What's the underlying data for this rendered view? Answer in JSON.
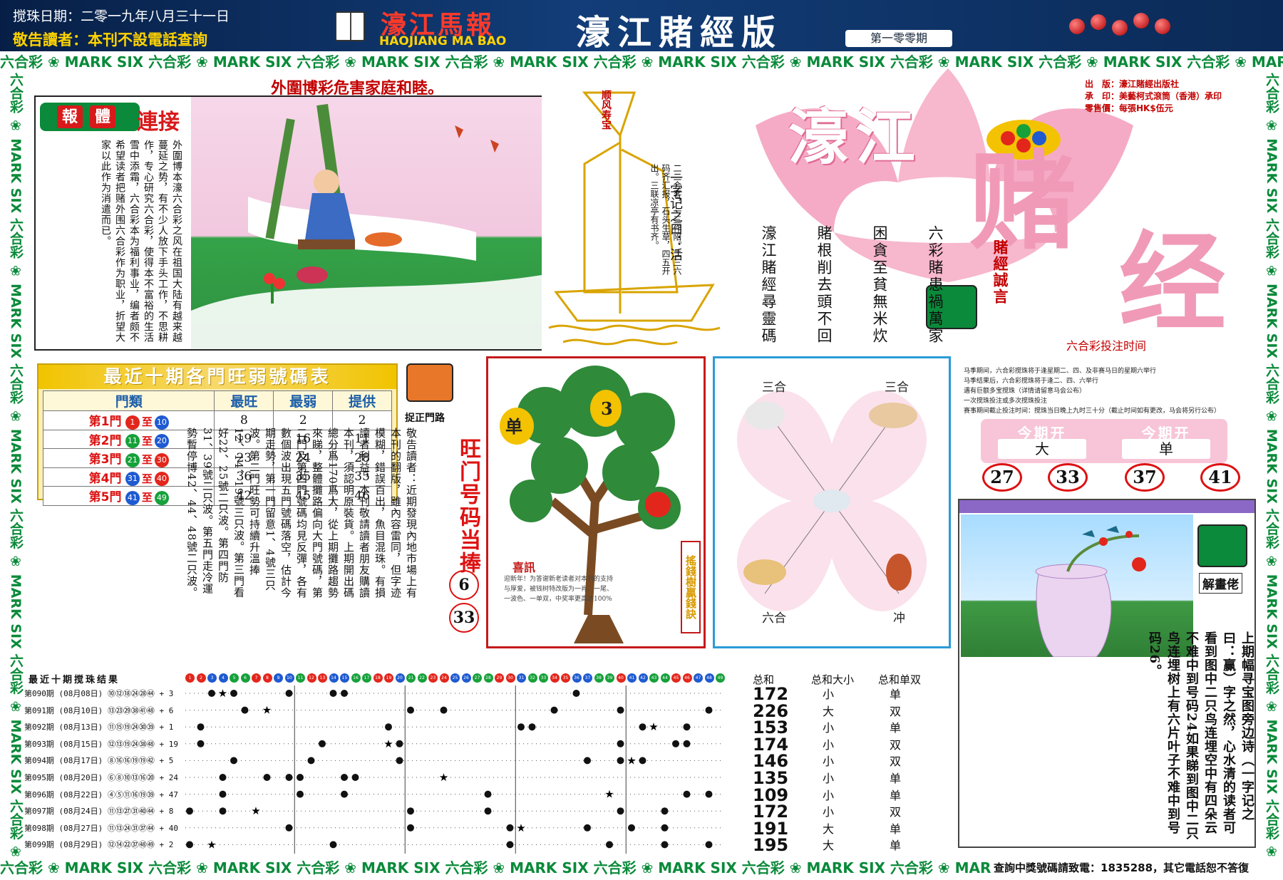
{
  "header": {
    "date": "搅珠日期：二零一九年八月三十一日",
    "notice": "敬告讀者：本刊不設電話查詢",
    "logo_cn": "濠江馬報",
    "logo_en": "HAOJIANG MA BAO",
    "edition": "濠江賭經版",
    "issue": "第一零零期"
  },
  "band_text": "六合彩 ❀ MARK SIX 六合彩 ❀ MARK SIX 六合彩 ❀ MARK SIX 六合彩 ❀ MARK SIX 六合彩 ❀ MARK SIX 六合彩 ❀ MARK SIX 六合彩 ❀ MARK SIX 六合彩 ❀ MARK SIX 六合彩 ❀ MARK SIX 六合彩 ❀ MARK SIX",
  "headline": "外圍博彩危害家庭和睦。",
  "pic_panel": {
    "badge_1": "報",
    "badge_2": "體",
    "badge_3": "連接",
    "body": "外圍博本濠六合彩之风在祖国大陆有越来越蔓延之势，有不少人放下手头工作，不思耕作，专心研究六合彩，使得本不富裕的生活雪中添霜，六合彩本为福利事业，编者颇不希望读者把赌外围六合彩作为职业，折望大家以此作为消遣而已。"
  },
  "ship": {
    "flag": "顺风寿宝",
    "poem": "二二会客，一三作陪。二三六码齐汇报，石头生草，四五开出。三联凉亭有书齐。",
    "title": "一字记之曰：活"
  },
  "logo": {
    "word_1": "濠江",
    "word_2": "赌",
    "word_3": "经"
  },
  "publisher": {
    "line_1": "出　版：濠江賭經出版社",
    "line_2": "承　印：美藝柯式滾筒（香港）承印",
    "line_3": "零售價：每張HK$伍元"
  },
  "motto": {
    "title": "賭經誠言",
    "col_1": "六彩賭患禍萬家",
    "col_2": "困貪至貧無米炊",
    "col_3": "賭根削去頭不回",
    "col_4": "濠江賭經尋靈碼"
  },
  "bet_time_title": "六合彩投注时间",
  "table": {
    "title": "最近十期各門旺弱號碼表",
    "headers": [
      "門類",
      "最旺",
      "最弱",
      "提供"
    ],
    "sep": "至",
    "rows": [
      {
        "door": "第1門",
        "from": "1",
        "to": "10",
        "hot": "8",
        "cold": "2",
        "offer": "2",
        "c1": "#e3261c",
        "c2": "#1f5ad1"
      },
      {
        "door": "第2門",
        "from": "11",
        "to": "20",
        "hot": "19",
        "cold": "16",
        "offer": "11",
        "c1": "#16a13a",
        "c2": "#1f5ad1"
      },
      {
        "door": "第3門",
        "from": "21",
        "to": "30",
        "hot": "23",
        "cold": "24",
        "offer": "28",
        "c1": "#16a13a",
        "c2": "#e3261c"
      },
      {
        "door": "第4門",
        "from": "31",
        "to": "40",
        "hot": "36",
        "cold": "35",
        "offer": "35",
        "c1": "#1f5ad1",
        "c2": "#e3261c"
      },
      {
        "door": "第5門",
        "from": "41",
        "to": "49",
        "hot": "42",
        "cold": "45",
        "offer": "46",
        "c1": "#1f5ad1",
        "c2": "#16a13a"
      }
    ]
  },
  "strategy": {
    "label": "捉正門路",
    "body": "敬告讀者：近期發現內地市場上有本刊的翻版，雖內容雷同，但字迹模糊，錯誤百出，魚目混珠。有損讀者利益，本刊敬請讀者朋友購讀本刊，須認明原裝貨。上期開出碼總分爲170爲大，從上期攤路趨勢來睇，整體攤路偏向大門號碼，第二門及第四門號碼均見反彈，各有數個波出現五門號碼落空，估計今期走勢，第一門留意1、4號三只波。第二門旺勢可持續升溫捧12、14、19號三只波。第三門看好22、25號二只波。第四門防31、39號二只波。第五門走冷運勢暫停博42、44、48號二只波。",
    "hot_title": "旺门号码当捧",
    "hot_1": "6",
    "hot_2": "33"
  },
  "tree": {
    "label_1": "单",
    "label_2": "3",
    "title": "喜訊",
    "text": "迎新年！为答谢新老读者对本刊的支持与厚爱，被钱树特改版为一肖、一尾、一波色、一单双，中奖率更高达100%",
    "side": "搖錢樹贏錢訣"
  },
  "zodiac": {
    "tl": "三合",
    "tr": "三合",
    "bl": "六合",
    "br": "冲"
  },
  "bet_info": [
    "马季期间，六合彩搅珠将于逢星期二、四、及非赛马日的星期六举行",
    "马季结果后，六合彩搅珠将于逢二、四、六举行",
    "遇有巨额多宝搅珠（详情请留意马会公布）",
    "一次搅珠投注或多次搅珠投注",
    "赛事期间截止投注时间：搅珠当日晚上九时三十分（截止时间如有更改，马会将另行公布）"
  ],
  "period": {
    "tag": "今期开",
    "val_1": "大",
    "val_2": "单"
  },
  "results": [
    "27",
    "33",
    "37",
    "41"
  ],
  "decode": {
    "label": "解畫佬",
    "body": "上期幅寻宝图旁边诗（一字记之曰：赢）字之然，心水清的读者可看到图中二只鸟连埋空中有四朵云不难中到号码24如果睇到图中二只鸟连埋树上有六片叶子不难中到号码26。"
  },
  "draw_chart": {
    "title": "最近十期搅珠结果",
    "ball_colors": [
      "#e3261c",
      "#e3261c",
      "#1f5ad1",
      "#1f5ad1",
      "#16a13a",
      "#16a13a",
      "#e3261c",
      "#e3261c",
      "#1f5ad1",
      "#1f5ad1",
      "#16a13a",
      "#e3261c",
      "#e3261c",
      "#1f5ad1",
      "#1f5ad1",
      "#16a13a",
      "#16a13a",
      "#e3261c",
      "#e3261c",
      "#1f5ad1",
      "#16a13a",
      "#16a13a",
      "#e3261c",
      "#e3261c",
      "#1f5ad1",
      "#1f5ad1",
      "#16a13a",
      "#16a13a",
      "#e3261c",
      "#e3261c",
      "#1f5ad1",
      "#16a13a",
      "#16a13a",
      "#e3261c",
      "#e3261c",
      "#1f5ad1",
      "#1f5ad1",
      "#16a13a",
      "#16a13a",
      "#e3261c",
      "#1f5ad1",
      "#1f5ad1",
      "#16a13a",
      "#16a13a",
      "#e3261c",
      "#e3261c",
      "#1f5ad1",
      "#1f5ad1",
      "#16a13a"
    ],
    "headers": {
      "sum": "总和",
      "big_small": "总和大小",
      "odd_even": "总和单双"
    },
    "rows": [
      {
        "label": "第090期 (08月08日) ⑩⑫⑱㉔㉘㊹ + 3",
        "dots": [
          3,
          5,
          10,
          14,
          15,
          36
        ],
        "star": 4,
        "sum": "172",
        "bs": "小",
        "oe": "单"
      },
      {
        "label": "第091期 (08月10日) ⑬㉓㉙㊳㊶㊽ + 6",
        "dots": [
          6,
          21,
          24,
          34,
          40,
          48
        ],
        "star": 8,
        "sum": "226",
        "bs": "大",
        "oe": "双"
      },
      {
        "label": "第092期 (08月13日) ⑪⑮⑲㉔㉚㊴ + 1",
        "dots": [
          2,
          19,
          31,
          32,
          42,
          46
        ],
        "star": 43,
        "sum": "153",
        "bs": "小",
        "oe": "单"
      },
      {
        "label": "第093期 (08月15日) ⑫⑬⑲㉔㊳㊽ + 19",
        "dots": [
          2,
          13,
          20,
          40,
          45,
          46
        ],
        "star": 19,
        "sum": "174",
        "bs": "小",
        "oe": "双"
      },
      {
        "label": "第094期 (08月17日) ⑧⑯⑯⑲⑲㊷ + 5",
        "dots": [
          5,
          12,
          20,
          37,
          40,
          42
        ],
        "star": 41,
        "sum": "146",
        "bs": "小",
        "oe": "双"
      },
      {
        "label": "第095期 (08月20日) ⑥⑧⑩⑬⑯⑳ + 24",
        "dots": [
          4,
          8,
          10,
          11,
          15,
          16
        ],
        "star": 24,
        "sum": "135",
        "bs": "小",
        "oe": "单"
      },
      {
        "label": "第096期 (08月22日) ④⑤⑪⑯⑲㊴ + 47",
        "dots": [
          4,
          11,
          15,
          28,
          46,
          48
        ],
        "star": 39,
        "sum": "109",
        "bs": "小",
        "oe": "单"
      },
      {
        "label": "第097期 (08月24日) ⑪⑬㉗㉛㊵㊹ + 8",
        "dots": [
          1,
          4,
          21,
          28,
          40,
          44
        ],
        "star": 7,
        "sum": "172",
        "bs": "小",
        "oe": "双"
      },
      {
        "label": "第098期 (08月27日) ⑪⑬㉔㉛㊲㊹ + 40",
        "dots": [
          10,
          21,
          30,
          37,
          41,
          44
        ],
        "star": 31,
        "sum": "191",
        "bs": "大",
        "oe": "单"
      },
      {
        "label": "第099期 (08月29日) ⑫⑭㉒㊲㊽㊾ + 2",
        "dots": [
          1,
          14,
          30,
          39,
          44,
          48
        ],
        "star": 3,
        "sum": "195",
        "bs": "大",
        "oe": "单"
      }
    ]
  },
  "footer_phone": "查詢中獎號碼請致電：1835288，其它電話恕不答復",
  "colors": {
    "red": "#d11",
    "green": "#0a8a3a",
    "navy": "#0b2a57",
    "gold": "#f1c400"
  }
}
